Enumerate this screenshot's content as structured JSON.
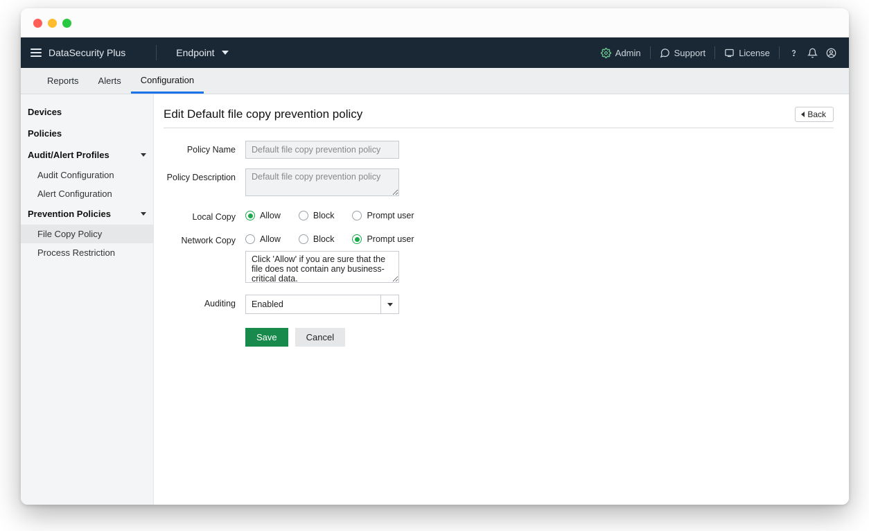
{
  "appbar": {
    "app_name": "DataSecurity Plus",
    "module": "Endpoint",
    "links": {
      "admin": "Admin",
      "support": "Support",
      "license": "License"
    }
  },
  "tabs": {
    "reports": "Reports",
    "alerts": "Alerts",
    "configuration": "Configuration",
    "active": "configuration"
  },
  "sidebar": {
    "devices": "Devices",
    "policies": "Policies",
    "audit_profiles": "Audit/Alert Profiles",
    "audit_children": {
      "audit_config": "Audit Configuration",
      "alert_config": "Alert Configuration"
    },
    "prevention_policies": "Prevention Policies",
    "prevention_children": {
      "file_copy": "File Copy Policy",
      "process_restriction": "Process Restriction"
    },
    "active": "file_copy"
  },
  "page": {
    "title": "Edit Default file copy prevention policy",
    "back": "Back"
  },
  "form": {
    "labels": {
      "policy_name": "Policy Name",
      "policy_description": "Policy Description",
      "local_copy": "Local Copy",
      "network_copy": "Network Copy",
      "auditing": "Auditing"
    },
    "policy_name_value": "Default file copy prevention policy",
    "policy_description_value": "Default file copy prevention policy",
    "radio_options": {
      "allow": "Allow",
      "block": "Block",
      "prompt": "Prompt user"
    },
    "local_copy_selected": "allow",
    "network_copy_selected": "prompt",
    "prompt_message": "Click 'Allow' if you are sure that the file does not contain any business-critical data.",
    "auditing_value": "Enabled",
    "buttons": {
      "save": "Save",
      "cancel": "Cancel"
    }
  }
}
